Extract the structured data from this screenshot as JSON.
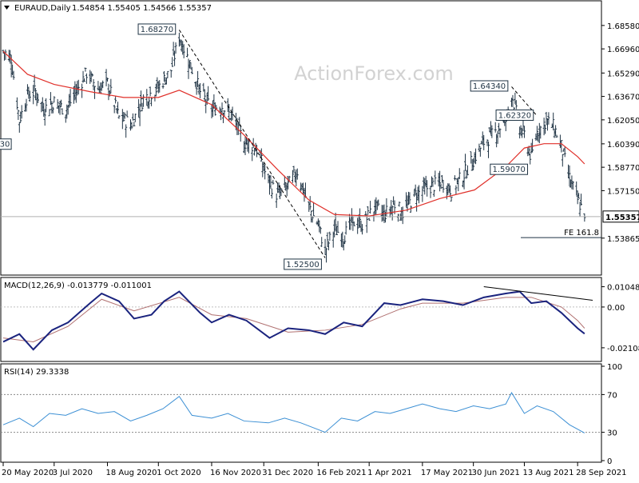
{
  "chart_data": [
    {
      "type": "ohlc",
      "title": "EURAUD,Daily",
      "header_values": [
        "1.54854",
        "1.55405",
        "1.54566",
        "1.55357"
      ],
      "watermark": "ActionForex.com",
      "colors": {
        "bars": "#1f3344",
        "ma": "#e0302a",
        "trendline": "#000000",
        "price_line": "#b0b0b0",
        "fib_line": "#1f3344"
      },
      "y_ticks": [
        "1.68580",
        "1.66960",
        "1.65290",
        "1.63670",
        "1.62050",
        "1.60390",
        "1.58770",
        "1.57150",
        "1.55357",
        "1.53865"
      ],
      "ylim": [
        1.5175,
        1.699
      ],
      "current_price_label": "1.55357",
      "current_price": 1.55357,
      "left_cut_label": "30",
      "left_cut_price": 1.6037,
      "annotations": [
        {
          "label": "1.68270",
          "value": 1.6827,
          "date": "2020-10-19"
        },
        {
          "label": "1.52500",
          "value": 1.525,
          "date": "2021-02-22"
        },
        {
          "label": "1.64340",
          "value": 1.6434,
          "date": "2021-08-02"
        },
        {
          "label": "1.62320",
          "value": 1.6232,
          "date": "2021-08-24"
        },
        {
          "label": "1.59070",
          "value": 1.5907,
          "date": "2021-08-19"
        }
      ],
      "fib_label": "FE 161.8",
      "fib_value": 1.539,
      "trendlines": [
        {
          "from": {
            "date": "2020-10-19",
            "value": 1.6827
          },
          "to": {
            "date": "2021-02-22",
            "value": 1.525
          }
        },
        {
          "from": {
            "date": "2021-08-02",
            "value": 1.6434
          },
          "to": {
            "date": "2021-08-24",
            "value": 1.6232
          }
        }
      ],
      "close_path": [
        [
          "2020-05-20",
          1.668
        ],
        [
          "2020-05-27",
          1.663
        ],
        [
          "2020-06-03",
          1.62
        ],
        [
          "2020-06-10",
          1.638
        ],
        [
          "2020-06-17",
          1.64
        ],
        [
          "2020-06-24",
          1.628
        ],
        [
          "2020-07-03",
          1.633
        ],
        [
          "2020-07-13",
          1.627
        ],
        [
          "2020-07-22",
          1.64
        ],
        [
          "2020-07-31",
          1.653
        ],
        [
          "2020-08-10",
          1.642
        ],
        [
          "2020-08-18",
          1.646
        ],
        [
          "2020-08-28",
          1.622
        ],
        [
          "2020-09-08",
          1.618
        ],
        [
          "2020-09-18",
          1.635
        ],
        [
          "2020-10-01",
          1.643
        ],
        [
          "2020-10-12",
          1.655
        ],
        [
          "2020-10-19",
          1.678
        ],
        [
          "2020-10-28",
          1.66
        ],
        [
          "2020-11-06",
          1.64
        ],
        [
          "2020-11-16",
          1.628
        ],
        [
          "2020-11-25",
          1.63
        ],
        [
          "2020-12-04",
          1.622
        ],
        [
          "2020-12-14",
          1.605
        ],
        [
          "2020-12-24",
          1.602
        ],
        [
          "2021-01-04",
          1.578
        ],
        [
          "2021-01-12",
          1.568
        ],
        [
          "2021-01-21",
          1.575
        ],
        [
          "2021-01-29",
          1.585
        ],
        [
          "2021-02-08",
          1.56
        ],
        [
          "2021-02-16",
          1.548
        ],
        [
          "2021-02-22",
          1.53
        ],
        [
          "2021-03-02",
          1.545
        ],
        [
          "2021-03-10",
          1.54
        ],
        [
          "2021-03-18",
          1.55
        ],
        [
          "2021-03-26",
          1.548
        ],
        [
          "2021-04-06",
          1.56
        ],
        [
          "2021-04-14",
          1.555
        ],
        [
          "2021-04-23",
          1.562
        ],
        [
          "2021-04-30",
          1.556
        ],
        [
          "2021-05-10",
          1.568
        ],
        [
          "2021-05-17",
          1.572
        ],
        [
          "2021-05-26",
          1.575
        ],
        [
          "2021-06-04",
          1.577
        ],
        [
          "2021-06-11",
          1.572
        ],
        [
          "2021-06-21",
          1.582
        ],
        [
          "2021-06-30",
          1.593
        ],
        [
          "2021-07-09",
          1.605
        ],
        [
          "2021-07-19",
          1.612
        ],
        [
          "2021-07-28",
          1.62
        ],
        [
          "2021-08-02",
          1.639
        ],
        [
          "2021-08-09",
          1.615
        ],
        [
          "2021-08-13",
          1.61
        ],
        [
          "2021-08-19",
          1.594
        ],
        [
          "2021-08-24",
          1.612
        ],
        [
          "2021-09-01",
          1.62
        ],
        [
          "2021-09-08",
          1.615
        ],
        [
          "2021-09-14",
          1.602
        ],
        [
          "2021-09-21",
          1.58
        ],
        [
          "2021-09-28",
          1.565
        ],
        [
          "2021-10-04",
          1.556
        ]
      ],
      "ma_path": [
        [
          "2020-05-20",
          1.668
        ],
        [
          "2020-06-10",
          1.652
        ],
        [
          "2020-07-03",
          1.645
        ],
        [
          "2020-08-03",
          1.64
        ],
        [
          "2020-09-01",
          1.636
        ],
        [
          "2020-10-01",
          1.636
        ],
        [
          "2020-10-19",
          1.641
        ],
        [
          "2020-11-16",
          1.631
        ],
        [
          "2020-12-14",
          1.61
        ],
        [
          "2021-01-12",
          1.586
        ],
        [
          "2021-02-08",
          1.565
        ],
        [
          "2021-03-02",
          1.555
        ],
        [
          "2021-04-01",
          1.554
        ],
        [
          "2021-05-03",
          1.558
        ],
        [
          "2021-06-01",
          1.566
        ],
        [
          "2021-07-01",
          1.572
        ],
        [
          "2021-07-28",
          1.588
        ],
        [
          "2021-08-13",
          1.601
        ],
        [
          "2021-08-30",
          1.604
        ],
        [
          "2021-09-14",
          1.604
        ],
        [
          "2021-09-28",
          1.595
        ],
        [
          "2021-10-04",
          1.59
        ]
      ]
    },
    {
      "type": "line",
      "title": "MACD(12,26,9) -0.013779 -0.011001",
      "y_ticks": [
        "0.010489",
        "0.00",
        "-0.021083"
      ],
      "ylim": [
        -0.0265,
        0.0132
      ],
      "zero_label": "0.00",
      "colors": {
        "macd": "#1a237e",
        "signal": "#b07070"
      },
      "series": [
        {
          "points": [
            [
              "2020-05-20",
              -0.018
            ],
            [
              "2020-06-03",
              -0.014
            ],
            [
              "2020-06-15",
              -0.022
            ],
            [
              "2020-07-01",
              -0.012
            ],
            [
              "2020-07-15",
              -0.008
            ],
            [
              "2020-08-03",
              0.002
            ],
            [
              "2020-08-13",
              0.007
            ],
            [
              "2020-08-28",
              0.003
            ],
            [
              "2020-09-10",
              -0.006
            ],
            [
              "2020-09-25",
              -0.004
            ],
            [
              "2020-10-06",
              0.003
            ],
            [
              "2020-10-19",
              0.008
            ],
            [
              "2020-11-06",
              -0.003
            ],
            [
              "2020-11-16",
              -0.008
            ],
            [
              "2020-12-01",
              -0.004
            ],
            [
              "2020-12-16",
              -0.007
            ],
            [
              "2021-01-05",
              -0.016
            ],
            [
              "2021-01-21",
              -0.011
            ],
            [
              "2021-02-08",
              -0.012
            ],
            [
              "2021-02-22",
              -0.014
            ],
            [
              "2021-03-10",
              -0.008
            ],
            [
              "2021-03-26",
              -0.01
            ],
            [
              "2021-04-14",
              0.002
            ],
            [
              "2021-04-28",
              0.001
            ],
            [
              "2021-05-17",
              0.004
            ],
            [
              "2021-06-04",
              0.003
            ],
            [
              "2021-06-21",
              0.001
            ],
            [
              "2021-07-09",
              0.005
            ],
            [
              "2021-07-28",
              0.007
            ],
            [
              "2021-08-09",
              0.008
            ],
            [
              "2021-08-19",
              0.002
            ],
            [
              "2021-09-01",
              0.003
            ],
            [
              "2021-09-14",
              -0.003
            ],
            [
              "2021-09-28",
              -0.011
            ],
            [
              "2021-10-04",
              -0.0138
            ]
          ]
        },
        {
          "points": [
            [
              "2020-05-20",
              -0.016
            ],
            [
              "2020-06-15",
              -0.018
            ],
            [
              "2020-07-15",
              -0.01
            ],
            [
              "2020-08-13",
              0.004
            ],
            [
              "2020-09-10",
              -0.002
            ],
            [
              "2020-10-19",
              0.005
            ],
            [
              "2020-11-16",
              -0.004
            ],
            [
              "2020-12-16",
              -0.006
            ],
            [
              "2021-01-21",
              -0.013
            ],
            [
              "2021-02-22",
              -0.012
            ],
            [
              "2021-03-26",
              -0.009
            ],
            [
              "2021-04-28",
              -0.001
            ],
            [
              "2021-05-17",
              0.002
            ],
            [
              "2021-06-21",
              0.002
            ],
            [
              "2021-07-28",
              0.005
            ],
            [
              "2021-08-19",
              0.005
            ],
            [
              "2021-09-14",
              0.0
            ],
            [
              "2021-09-28",
              -0.007
            ],
            [
              "2021-10-04",
              -0.011
            ]
          ]
        }
      ],
      "trendline": {
        "from": {
          "date": "2021-07-09",
          "value": 0.0105
        },
        "to": {
          "date": "2021-10-11",
          "value": 0.0035
        }
      }
    },
    {
      "type": "line",
      "title": "RSI(14) 29.3338",
      "y_ticks": [
        "100",
        "70",
        "30",
        "0"
      ],
      "ylim": [
        0,
        100
      ],
      "levels": [
        70,
        30
      ],
      "colors": {
        "rsi": "#3b8fd4",
        "levels": "#888888"
      },
      "series": [
        {
          "points": [
            [
              "2020-05-20",
              38
            ],
            [
              "2020-06-03",
              45
            ],
            [
              "2020-06-15",
              36
            ],
            [
              "2020-06-29",
              50
            ],
            [
              "2020-07-13",
              48
            ],
            [
              "2020-07-27",
              55
            ],
            [
              "2020-08-10",
              50
            ],
            [
              "2020-08-24",
              52
            ],
            [
              "2020-09-07",
              42
            ],
            [
              "2020-09-21",
              48
            ],
            [
              "2020-10-05",
              55
            ],
            [
              "2020-10-19",
              68
            ],
            [
              "2020-10-30",
              48
            ],
            [
              "2020-11-16",
              45
            ],
            [
              "2020-11-30",
              50
            ],
            [
              "2020-12-14",
              42
            ],
            [
              "2021-01-04",
              40
            ],
            [
              "2021-01-18",
              45
            ],
            [
              "2021-02-01",
              40
            ],
            [
              "2021-02-22",
              30
            ],
            [
              "2021-03-08",
              45
            ],
            [
              "2021-03-22",
              42
            ],
            [
              "2021-04-06",
              52
            ],
            [
              "2021-04-19",
              50
            ],
            [
              "2021-05-03",
              55
            ],
            [
              "2021-05-17",
              60
            ],
            [
              "2021-06-01",
              55
            ],
            [
              "2021-06-15",
              52
            ],
            [
              "2021-06-30",
              58
            ],
            [
              "2021-07-14",
              55
            ],
            [
              "2021-07-28",
              60
            ],
            [
              "2021-08-02",
              72
            ],
            [
              "2021-08-13",
              50
            ],
            [
              "2021-08-24",
              58
            ],
            [
              "2021-09-07",
              52
            ],
            [
              "2021-09-21",
              38
            ],
            [
              "2021-10-04",
              29.3
            ]
          ]
        }
      ]
    },
    {
      "type": "axis",
      "x_labels": [
        {
          "label": "20 May 2020",
          "date": "2020-05-20"
        },
        {
          "label": "3 Jul 2020",
          "date": "2020-07-03"
        },
        {
          "label": "18 Aug 2020",
          "date": "2020-08-18"
        },
        {
          "label": "1 Oct 2020",
          "date": "2020-10-01"
        },
        {
          "label": "16 Nov 2020",
          "date": "2020-11-16"
        },
        {
          "label": "31 Dec 2020",
          "date": "2020-12-31"
        },
        {
          "label": "16 Feb 2021",
          "date": "2021-02-16"
        },
        {
          "label": "1 Apr 2021",
          "date": "2021-04-01"
        },
        {
          "label": "17 May 2021",
          "date": "2021-05-17"
        },
        {
          "label": "30 Jun 2021",
          "date": "2021-06-30"
        },
        {
          "label": "13 Aug 2021",
          "date": "2021-08-13"
        },
        {
          "label": "28 Sep 2021",
          "date": "2021-09-28"
        }
      ],
      "x_range": [
        "2020-05-20",
        "2021-10-11"
      ]
    }
  ]
}
